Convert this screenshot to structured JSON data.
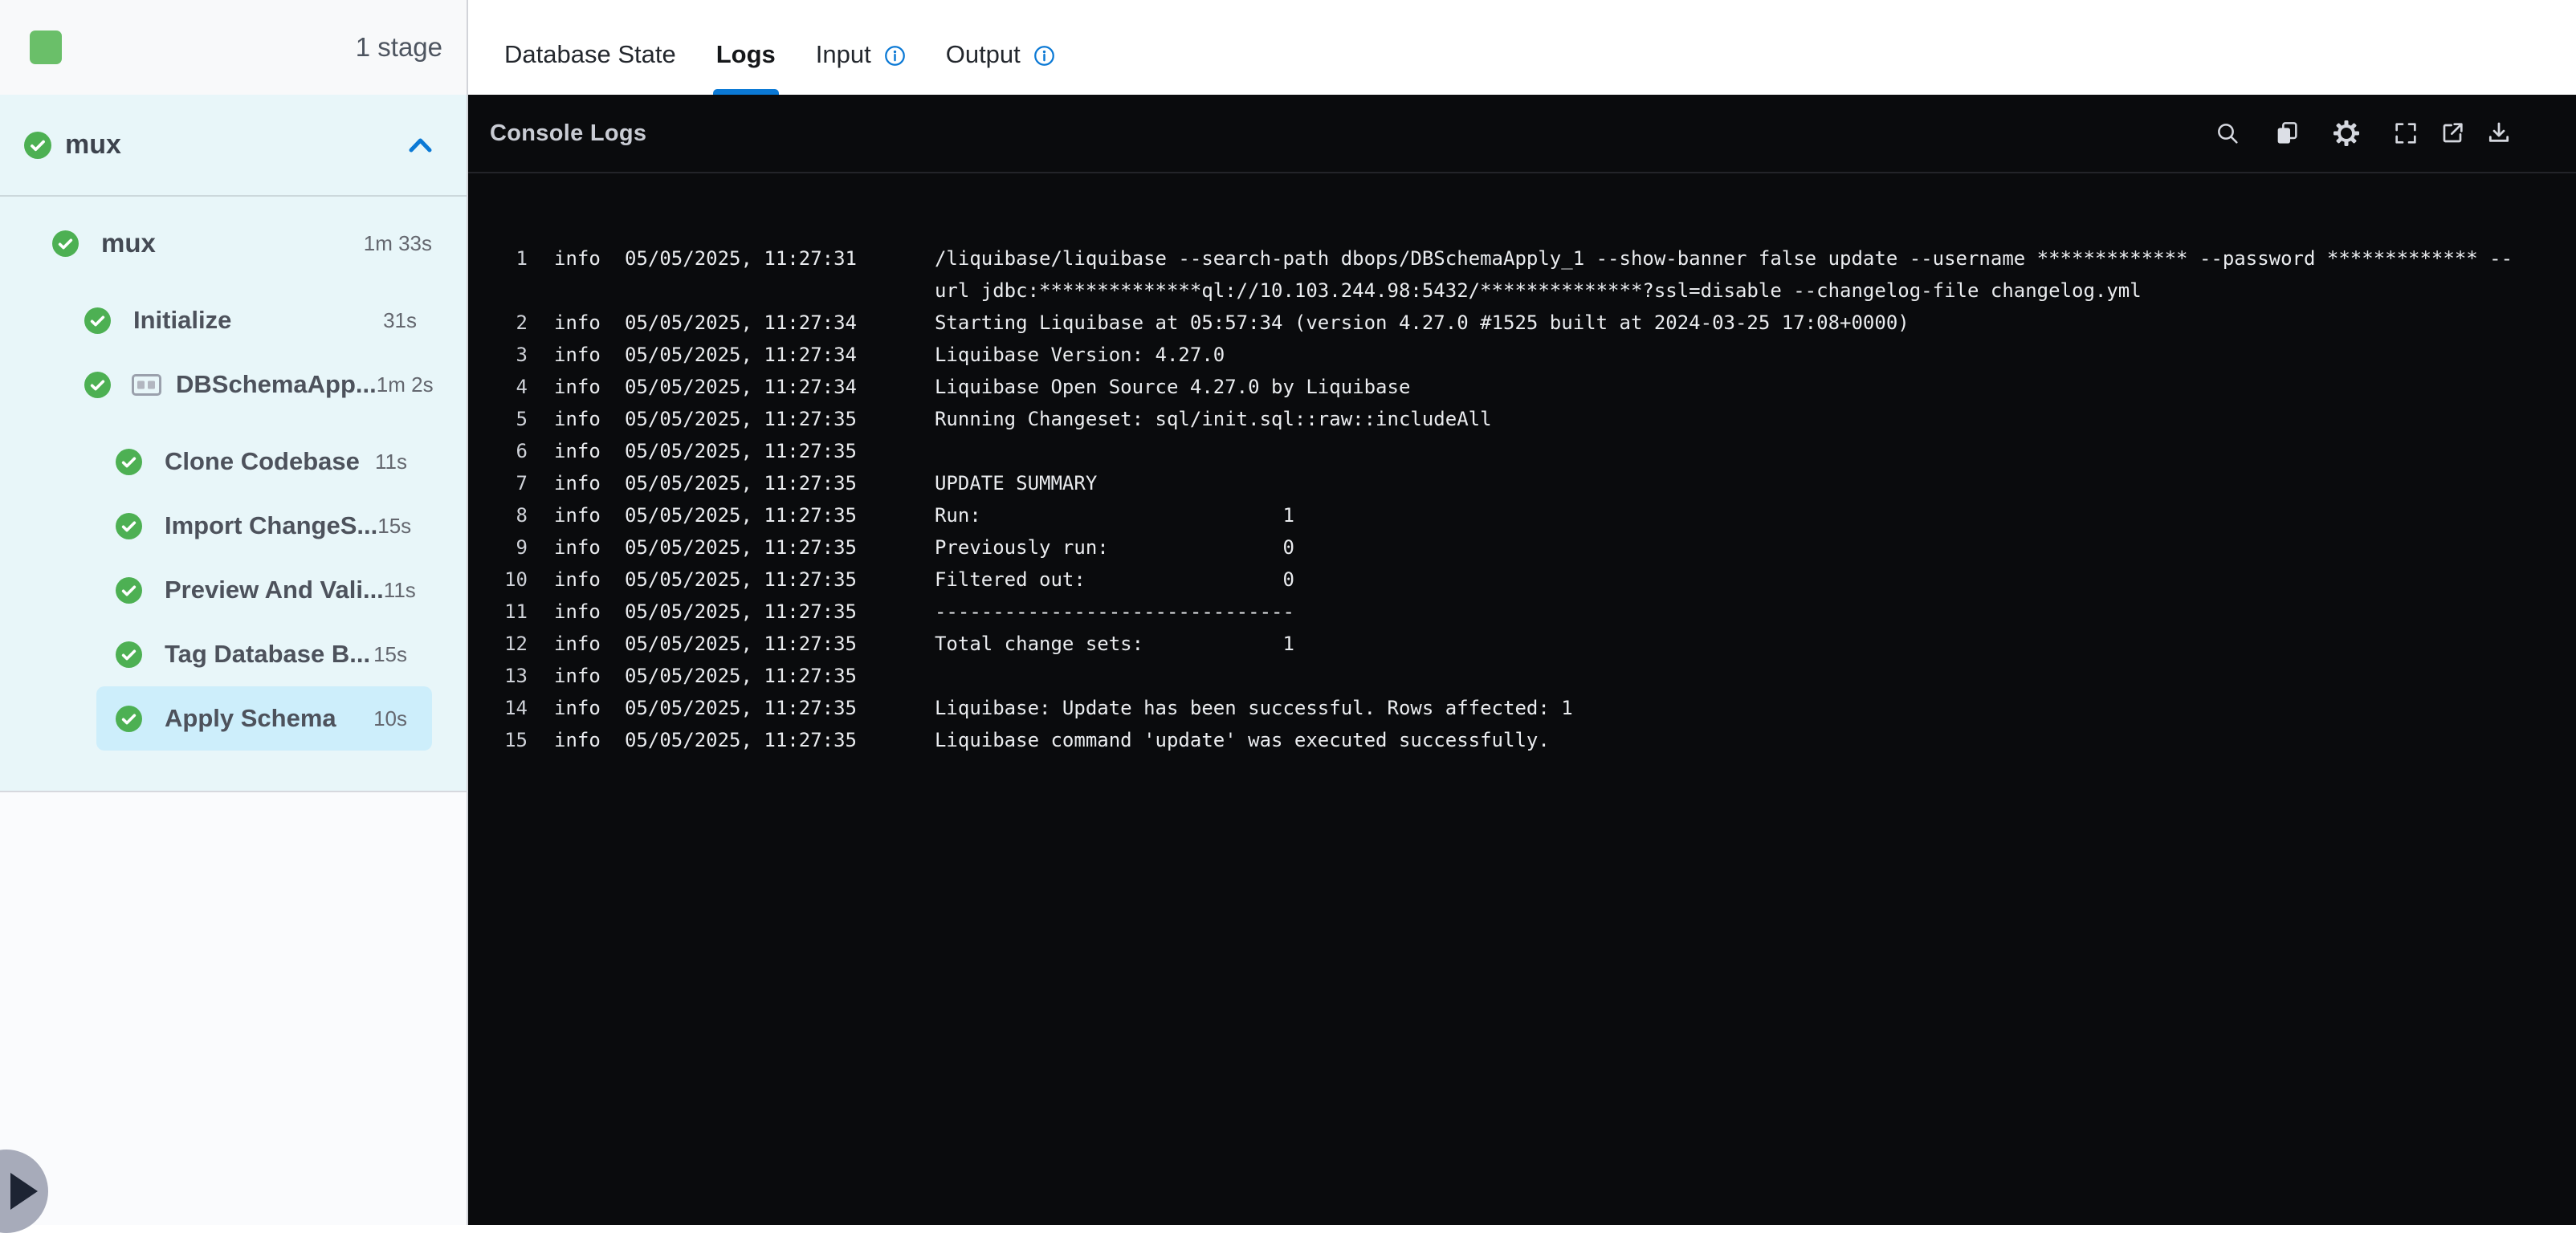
{
  "colors": {
    "accent_blue": "#0b79d5",
    "success_green": "#4db053",
    "selected_row": "#cdeefb",
    "console_bg": "#0a0b0d"
  },
  "header": {
    "stage_count": "1 stage"
  },
  "sidebar": {
    "pipeline": {
      "label": "mux",
      "collapse_icon": "chevron-up-icon"
    },
    "tree": [
      {
        "label": "mux",
        "duration": "1m 33s",
        "level": 0,
        "gap_after": true
      },
      {
        "label": "Initialize",
        "duration": "31s",
        "level": 1
      },
      {
        "label": "DBSchemaApp...",
        "duration": "1m 2s",
        "level": 1,
        "group_icon": true,
        "gap_after": true
      },
      {
        "label": "Clone Codebase",
        "duration": "11s",
        "level": 2
      },
      {
        "label": "Import ChangeS...",
        "duration": "15s",
        "level": 2
      },
      {
        "label": "Preview And Vali...",
        "duration": "11s",
        "level": 2
      },
      {
        "label": "Tag Database B...",
        "duration": "15s",
        "level": 2
      },
      {
        "label": "Apply Schema",
        "duration": "10s",
        "level": 2,
        "selected": true
      }
    ]
  },
  "tabs": [
    {
      "label": "Database State",
      "active": false,
      "info": false
    },
    {
      "label": "Logs",
      "active": true,
      "info": false
    },
    {
      "label": "Input",
      "active": false,
      "info": true
    },
    {
      "label": "Output",
      "active": false,
      "info": true
    }
  ],
  "console": {
    "title": "Console Logs",
    "toolbar_icons": [
      "search-icon",
      "copy-icon",
      "settings-icon",
      "fullscreen-icon",
      "open-in-new-icon",
      "download-icon"
    ],
    "logs": [
      {
        "n": "1",
        "level": "info",
        "time": "05/05/2025, 11:27:31",
        "lines": [
          "/liquibase/liquibase --search-path dbops/DBSchemaApply_1 --show-banner false update --username ************* --password ************* --",
          "url jdbc:**************ql://10.103.244.98:5432/**************?ssl=disable --changelog-file changelog.yml"
        ]
      },
      {
        "n": "2",
        "level": "info",
        "time": "05/05/2025, 11:27:34",
        "lines": [
          "Starting Liquibase at 05:57:34 (version 4.27.0 #1525 built at 2024-03-25 17:08+0000)"
        ]
      },
      {
        "n": "3",
        "level": "info",
        "time": "05/05/2025, 11:27:34",
        "lines": [
          "Liquibase Version: 4.27.0"
        ]
      },
      {
        "n": "4",
        "level": "info",
        "time": "05/05/2025, 11:27:34",
        "lines": [
          "Liquibase Open Source 4.27.0 by Liquibase"
        ]
      },
      {
        "n": "5",
        "level": "info",
        "time": "05/05/2025, 11:27:35",
        "lines": [
          "Running Changeset: sql/init.sql::raw::includeAll"
        ]
      },
      {
        "n": "6",
        "level": "info",
        "time": "05/05/2025, 11:27:35",
        "lines": [
          ""
        ]
      },
      {
        "n": "7",
        "level": "info",
        "time": "05/05/2025, 11:27:35",
        "lines": [
          "UPDATE SUMMARY"
        ]
      },
      {
        "n": "8",
        "level": "info",
        "time": "05/05/2025, 11:27:35",
        "lines": [
          "Run:                          1"
        ]
      },
      {
        "n": "9",
        "level": "info",
        "time": "05/05/2025, 11:27:35",
        "lines": [
          "Previously run:               0"
        ]
      },
      {
        "n": "10",
        "level": "info",
        "time": "05/05/2025, 11:27:35",
        "lines": [
          "Filtered out:                 0"
        ]
      },
      {
        "n": "11",
        "level": "info",
        "time": "05/05/2025, 11:27:35",
        "lines": [
          "-------------------------------"
        ]
      },
      {
        "n": "12",
        "level": "info",
        "time": "05/05/2025, 11:27:35",
        "lines": [
          "Total change sets:            1"
        ]
      },
      {
        "n": "13",
        "level": "info",
        "time": "05/05/2025, 11:27:35",
        "lines": [
          ""
        ]
      },
      {
        "n": "14",
        "level": "info",
        "time": "05/05/2025, 11:27:35",
        "lines": [
          "Liquibase: Update has been successful. Rows affected: 1"
        ]
      },
      {
        "n": "15",
        "level": "info",
        "time": "05/05/2025, 11:27:35",
        "lines": [
          "Liquibase command 'update' was executed successfully."
        ]
      }
    ]
  }
}
